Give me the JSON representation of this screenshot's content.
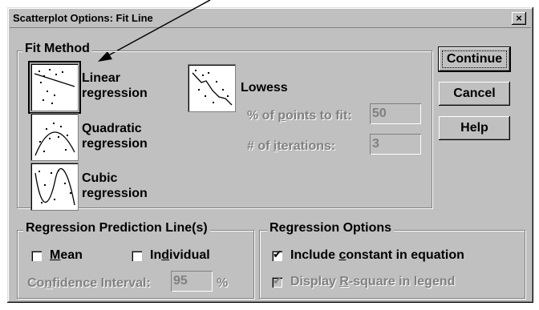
{
  "dialog": {
    "title": "Scatterplot Options: Fit Line",
    "close_glyph": "×"
  },
  "fit_method": {
    "label": "Fit Method",
    "options": [
      {
        "line1": "Linear",
        "line2": "regression",
        "selected": true
      },
      {
        "line1": "Quadratic",
        "line2": "regression",
        "selected": false
      },
      {
        "line1": "Cubic",
        "line2": "regression",
        "selected": false
      },
      {
        "line1": "Lowess",
        "line2": "",
        "selected": false
      }
    ],
    "points_to_fit": {
      "label_pre": "% of ",
      "label_u": "p",
      "label_post": "oints to fit:",
      "value": "50"
    },
    "iterations": {
      "label_pre": "# of ",
      "label_u": "i",
      "label_post": "terations:",
      "value": "3"
    }
  },
  "buttons": {
    "continue": "Continue",
    "cancel": "Cancel",
    "help": "Help"
  },
  "prediction": {
    "label": "Regression Prediction Line(s)",
    "mean": {
      "pre": "",
      "u": "M",
      "post": "ean",
      "checked": false
    },
    "individual": {
      "pre": "In",
      "u": "d",
      "post": "ividual",
      "checked": false
    },
    "confidence": {
      "pre": "Co",
      "u": "n",
      "post": "fidence Interval:",
      "value": "95",
      "unit": "%"
    }
  },
  "reg_options": {
    "label": "Regression Options",
    "include_constant": {
      "pre": "Include ",
      "u": "c",
      "post": "onstant in equation",
      "checked": true
    },
    "display_r2": {
      "pre": "Display ",
      "u": "R",
      "post": "-square in legend",
      "checked": true
    }
  },
  "check_glyph": "✔"
}
